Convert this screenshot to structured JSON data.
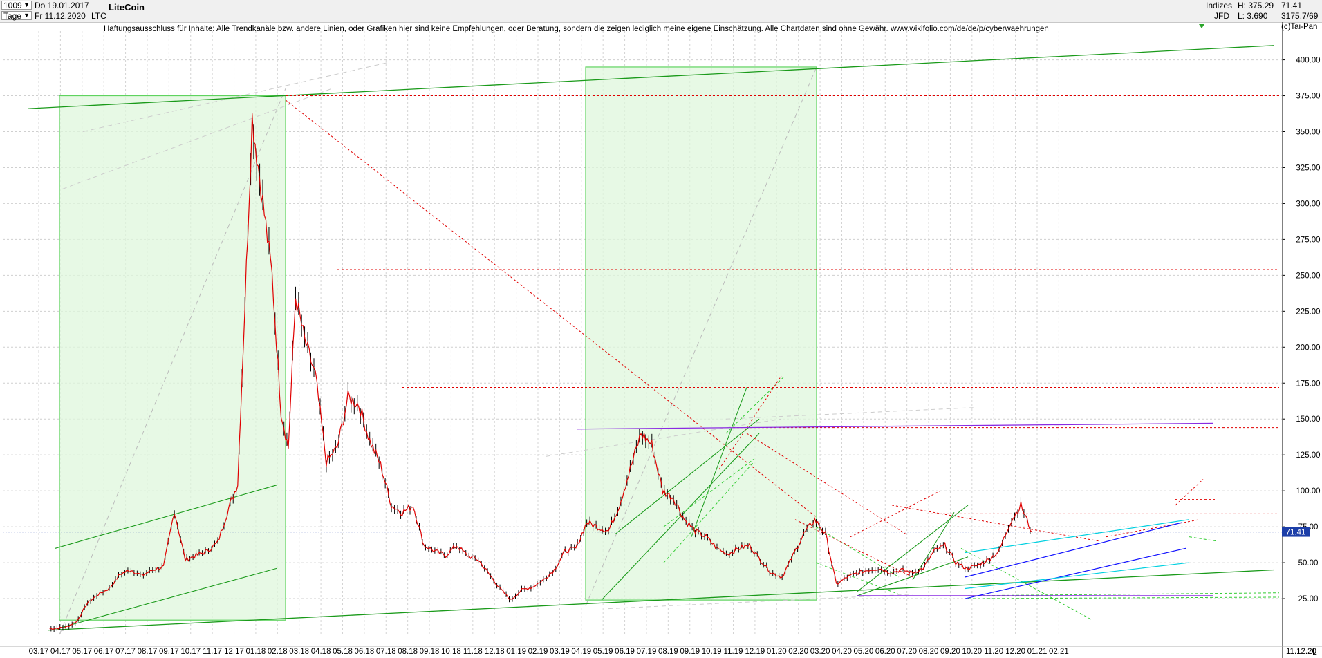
{
  "toolbar": {
    "count": "1009",
    "date_from": "Do 19.01.2017",
    "period": "Tage",
    "date_to": "Fr 11.12.2020",
    "instrument_name": "LiteCoin",
    "symbol": "LTC",
    "market": "Indizes",
    "broker": "JFD",
    "high_label": "H: 375.29",
    "low_label": "L: 3.690",
    "last_price": "71.41",
    "volume_info": "3175.7/69"
  },
  "disclaimer": "Haftungsausschluss für Inhalte: Alle Trendkanäle bzw. andere Linien, oder Grafiken hier sind keine Empfehlungen, oder Beratung, sondern die zeigen lediglich meine eigene Einschätzung. Alle Chartdaten sind ohne Gewähr.  www.wikifolio.com/de/de/p/cyberwaehrungen",
  "copyright": "(c)Tai-Pan",
  "footer": {
    "end_date": "11.12.20",
    "corner": "L"
  },
  "colors": {
    "price_line": "#e00000",
    "candle": "#000000",
    "channel_green": "#1a9a1a",
    "box_fill": "#dff7dc",
    "box_border": "#5fd35f",
    "resistance_red": "#e00000",
    "purple": "#8a2be2",
    "blue": "#1010ff",
    "cyan": "#00d0e0",
    "last_price_badge": "#1c3ea8"
  },
  "chart_data": {
    "type": "line",
    "title": "LiteCoin",
    "y_axis_side": "right",
    "ylim": [
      0,
      420
    ],
    "yticks": [
      25,
      50,
      75,
      100,
      125,
      150,
      175,
      200,
      225,
      250,
      275,
      300,
      325,
      350,
      375,
      400
    ],
    "ytick_labels": [
      "25.00",
      "50.00",
      "75.00",
      "100.00",
      "125.00",
      "150.00",
      "175.00",
      "200.00",
      "225.00",
      "250.00",
      "275.00",
      "300.00",
      "325.00",
      "350.00",
      "375.00",
      "400.00"
    ],
    "x_tick_labels": [
      "03.17",
      "04.17",
      "05.17",
      "06.17",
      "07.17",
      "08.17",
      "09.17",
      "10.17",
      "11.17",
      "12.17",
      "01.18",
      "02.18",
      "03.18",
      "04.18",
      "05.18",
      "06.18",
      "07.18",
      "08.18",
      "09.18",
      "10.18",
      "11.18",
      "12.18",
      "01.19",
      "02.19",
      "03.19",
      "04.19",
      "05.19",
      "06.19",
      "07.19",
      "08.19",
      "09.19",
      "10.19",
      "11.19",
      "12.19",
      "01.20",
      "02.20",
      "03.20",
      "04.20",
      "05.20",
      "06.20",
      "07.20",
      "08.20",
      "09.20",
      "10.20",
      "11.20",
      "12.20",
      "01.21",
      "02.21"
    ],
    "grid": true,
    "last_value": 71.41,
    "series": [
      {
        "values": [
          [
            "03.17",
            4
          ],
          [
            "04.17",
            5
          ],
          [
            "04.17",
            9
          ],
          [
            "05.17",
            22
          ],
          [
            "05.17",
            28
          ],
          [
            "06.17",
            32
          ],
          [
            "06.17",
            42
          ],
          [
            "07.17",
            45
          ],
          [
            "07.17",
            41
          ],
          [
            "08.17",
            45
          ],
          [
            "08.17",
            47
          ],
          [
            "09.17",
            86
          ],
          [
            "09.17",
            52
          ],
          [
            "10.17",
            55
          ],
          [
            "10.17",
            58
          ],
          [
            "11.17",
            64
          ],
          [
            "11.17",
            88
          ],
          [
            "12.17",
            105
          ],
          [
            "12.17",
            230
          ],
          [
            "12.17",
            360
          ],
          [
            "01.18",
            310
          ],
          [
            "01.18",
            250
          ],
          [
            "02.18",
            155
          ],
          [
            "02.18",
            130
          ],
          [
            "02.18",
            235
          ],
          [
            "03.18",
            205
          ],
          [
            "03.18",
            180
          ],
          [
            "04.18",
            120
          ],
          [
            "04.18",
            130
          ],
          [
            "05.18",
            165
          ],
          [
            "05.18",
            160
          ],
          [
            "06.18",
            135
          ],
          [
            "06.18",
            118
          ],
          [
            "07.18",
            90
          ],
          [
            "07.18",
            85
          ],
          [
            "08.18",
            90
          ],
          [
            "08.18",
            62
          ],
          [
            "09.18",
            58
          ],
          [
            "09.18",
            55
          ],
          [
            "10.18",
            62
          ],
          [
            "10.18",
            55
          ],
          [
            "11.18",
            52
          ],
          [
            "11.18",
            42
          ],
          [
            "12.18",
            32
          ],
          [
            "12.18",
            24
          ],
          [
            "01.19",
            31
          ],
          [
            "01.19",
            33
          ],
          [
            "02.19",
            38
          ],
          [
            "02.19",
            45
          ],
          [
            "03.19",
            58
          ],
          [
            "03.19",
            60
          ],
          [
            "04.19",
            78
          ],
          [
            "04.19",
            75
          ],
          [
            "05.19",
            72
          ],
          [
            "05.19",
            90
          ],
          [
            "06.19",
            115
          ],
          [
            "06.19",
            140
          ],
          [
            "07.19",
            132
          ],
          [
            "07.19",
            100
          ],
          [
            "08.19",
            95
          ],
          [
            "08.19",
            80
          ],
          [
            "09.19",
            72
          ],
          [
            "09.19",
            68
          ],
          [
            "10.19",
            60
          ],
          [
            "10.19",
            56
          ],
          [
            "11.19",
            60
          ],
          [
            "11.19",
            62
          ],
          [
            "12.19",
            52
          ],
          [
            "12.19",
            43
          ],
          [
            "01.20",
            40
          ],
          [
            "01.20",
            55
          ],
          [
            "02.20",
            70
          ],
          [
            "02.20",
            80
          ],
          [
            "03.20",
            70
          ],
          [
            "03.20",
            35
          ],
          [
            "04.20",
            40
          ],
          [
            "04.20",
            43
          ],
          [
            "05.20",
            45
          ],
          [
            "05.20",
            46
          ],
          [
            "06.20",
            43
          ],
          [
            "06.20",
            45
          ],
          [
            "07.20",
            43
          ],
          [
            "07.20",
            46
          ],
          [
            "08.20",
            58
          ],
          [
            "08.20",
            62
          ],
          [
            "09.20",
            50
          ],
          [
            "09.20",
            46
          ],
          [
            "10.20",
            48
          ],
          [
            "10.20",
            52
          ],
          [
            "11.20",
            58
          ],
          [
            "11.20",
            78
          ],
          [
            "12.20",
            90
          ],
          [
            "12.20",
            71.41
          ]
        ]
      }
    ]
  }
}
